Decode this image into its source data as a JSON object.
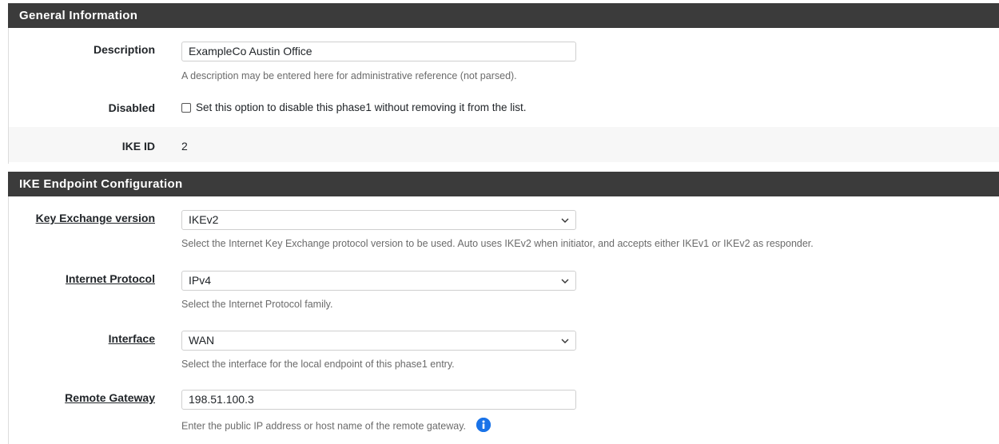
{
  "general": {
    "heading": "General Information",
    "description": {
      "label": "Description",
      "value": "ExampleCo Austin Office",
      "help": "A description may be entered here for administrative reference (not parsed)."
    },
    "disabled": {
      "label": "Disabled",
      "checked": false,
      "text": "Set this option to disable this phase1 without removing it from the list."
    },
    "ike_id": {
      "label": "IKE ID",
      "value": "2"
    }
  },
  "endpoint": {
    "heading": "IKE Endpoint Configuration",
    "key_exchange": {
      "label": "Key Exchange version",
      "value": "IKEv2",
      "help": "Select the Internet Key Exchange protocol version to be used. Auto uses IKEv2 when initiator, and accepts either IKEv1 or IKEv2 as responder."
    },
    "internet_protocol": {
      "label": "Internet Protocol",
      "value": "IPv4",
      "help": "Select the Internet Protocol family."
    },
    "interface": {
      "label": "Interface",
      "value": "WAN",
      "help": "Select the interface for the local endpoint of this phase1 entry."
    },
    "remote_gateway": {
      "label": "Remote Gateway",
      "value": "198.51.100.3",
      "help": "Enter the public IP address or host name of the remote gateway."
    }
  },
  "colors": {
    "heading_bg": "#3b3b3b",
    "info_icon": "#1a73e8"
  }
}
